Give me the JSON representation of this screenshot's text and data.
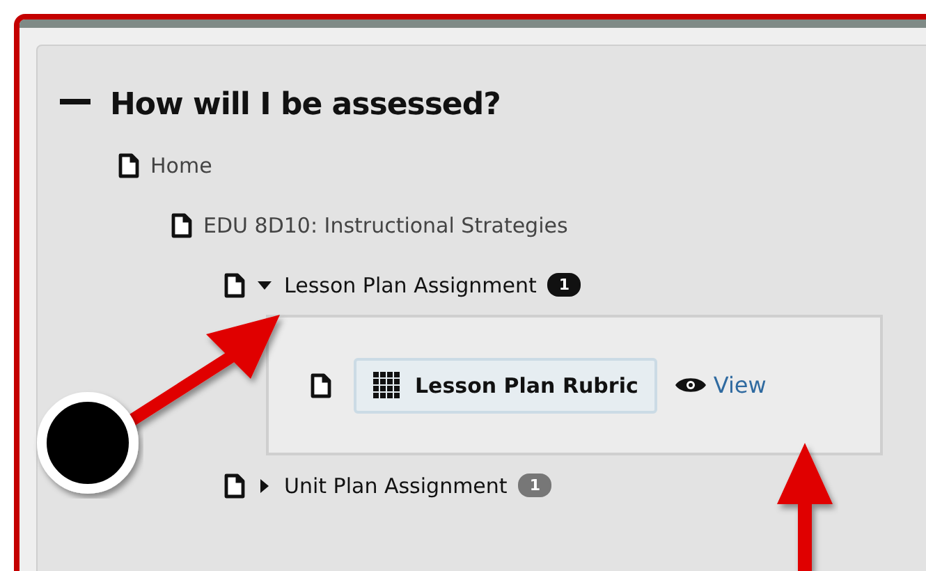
{
  "section": {
    "title": "How will I be assessed?",
    "expanded": true
  },
  "tree": [
    {
      "title": "Home",
      "children": [
        {
          "title": "EDU 8D10: Instructional Strategies",
          "children": [
            {
              "title": "Lesson Plan Assignment",
              "badge": "1",
              "expanded": true,
              "attachments": [
                {
                  "label": "Lesson Plan Rubric",
                  "action": "View"
                }
              ]
            },
            {
              "title": "Unit Plan Assignment",
              "badge": "1",
              "expanded": false
            }
          ]
        }
      ]
    }
  ]
}
